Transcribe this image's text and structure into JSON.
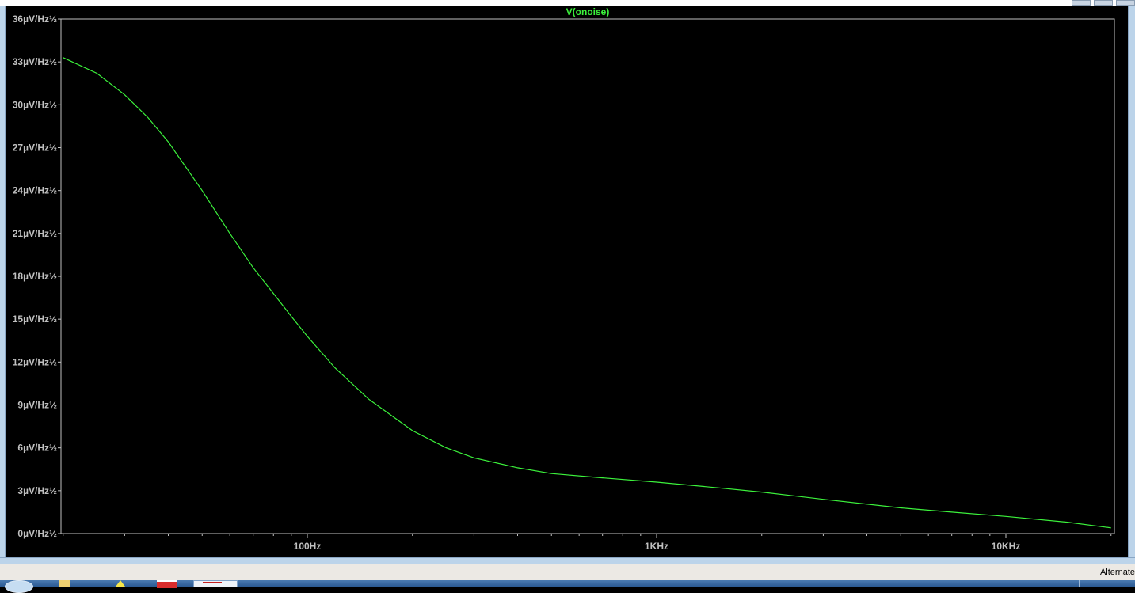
{
  "plot": {
    "trace_name": "V(onoise)",
    "trace_color": "#3cf23c",
    "background": "#000000",
    "axis_color": "#c0c0c0"
  },
  "chart_data": {
    "type": "line",
    "title": "V(onoise)",
    "xlabel": "",
    "ylabel": "",
    "x_scale": "log",
    "xlim": [
      10,
      20000
    ],
    "ylim": [
      0,
      36
    ],
    "x_ticks": [
      {
        "value": 100,
        "label": "100Hz"
      },
      {
        "value": 1000,
        "label": "1KHz"
      },
      {
        "value": 10000,
        "label": "10KHz"
      }
    ],
    "y_ticks": [
      {
        "value": 36,
        "label": "36µV/Hz½"
      },
      {
        "value": 33,
        "label": "33µV/Hz½"
      },
      {
        "value": 30,
        "label": "30µV/Hz½"
      },
      {
        "value": 27,
        "label": "27µV/Hz½"
      },
      {
        "value": 24,
        "label": "24µV/Hz½"
      },
      {
        "value": 21,
        "label": "21µV/Hz½"
      },
      {
        "value": 18,
        "label": "18µV/Hz½"
      },
      {
        "value": 15,
        "label": "15µV/Hz½"
      },
      {
        "value": 12,
        "label": "12µV/Hz½"
      },
      {
        "value": 9,
        "label": "9µV/Hz½"
      },
      {
        "value": 6,
        "label": "6µV/Hz½"
      },
      {
        "value": 3,
        "label": "3µV/Hz½"
      },
      {
        "value": 0,
        "label": "0µV/Hz½"
      }
    ],
    "series": [
      {
        "name": "V(onoise)",
        "color": "#3cf23c",
        "x": [
          20,
          25,
          30,
          35,
          40,
          50,
          60,
          70,
          80,
          90,
          100,
          120,
          150,
          200,
          250,
          300,
          400,
          500,
          700,
          1000,
          1500,
          2000,
          3000,
          5000,
          7000,
          10000,
          15000,
          20000
        ],
        "y": [
          33.3,
          32.2,
          30.7,
          29.1,
          27.4,
          24.0,
          21.0,
          18.6,
          16.8,
          15.2,
          13.8,
          11.6,
          9.4,
          7.2,
          6.0,
          5.3,
          4.6,
          4.2,
          3.9,
          3.6,
          3.2,
          2.9,
          2.4,
          1.8,
          1.5,
          1.2,
          0.8,
          0.4
        ]
      }
    ]
  },
  "status_bar": {
    "text": "Alternate"
  }
}
